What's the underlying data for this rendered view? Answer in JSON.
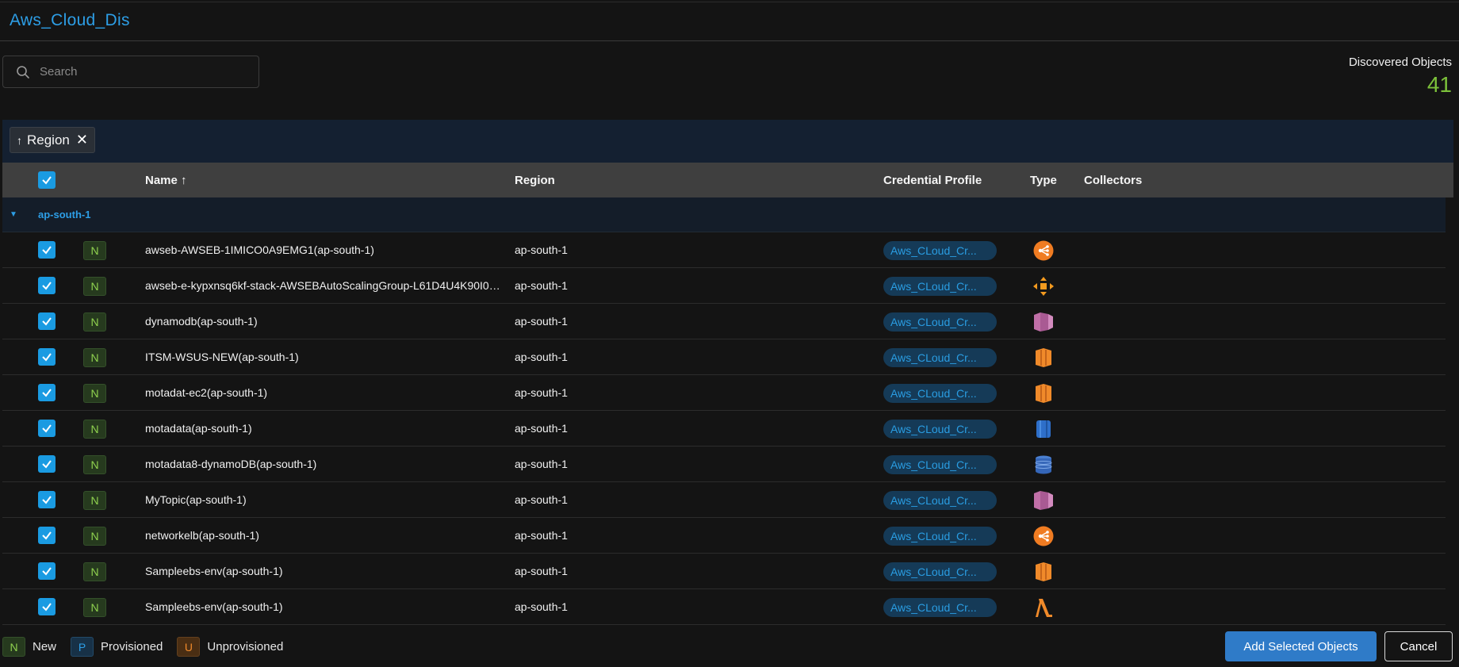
{
  "header": {
    "title": "Aws_Cloud_Dis"
  },
  "search": {
    "placeholder": "Search"
  },
  "discovered": {
    "label": "Discovered Objects",
    "count": "41"
  },
  "groupby": {
    "arrow": "↑",
    "label": "Region",
    "remove": "✕"
  },
  "columns": {
    "name": "Name ↑",
    "region": "Region",
    "credential": "Credential Profile",
    "type": "Type",
    "collectors": "Collectors"
  },
  "group": {
    "toggle": "▼",
    "name": "ap-south-1"
  },
  "rows": [
    {
      "status": "N",
      "name": "awseb-AWSEB-1IMICO0A9EMG1(ap-south-1)",
      "region": "ap-south-1",
      "credential": "Aws_CLoud_Cr...",
      "type_icon": "elb-icon"
    },
    {
      "status": "N",
      "name": "awseb-e-kypxnsq6kf-stack-AWSEBAutoScalingGroup-L61D4U4K90I0(...",
      "region": "ap-south-1",
      "credential": "Aws_CLoud_Cr...",
      "type_icon": "autoscaling-icon"
    },
    {
      "status": "N",
      "name": "dynamodb(ap-south-1)",
      "region": "ap-south-1",
      "credential": "Aws_CLoud_Cr...",
      "type_icon": "sns-icon"
    },
    {
      "status": "N",
      "name": "ITSM-WSUS-NEW(ap-south-1)",
      "region": "ap-south-1",
      "credential": "Aws_CLoud_Cr...",
      "type_icon": "ec2-icon"
    },
    {
      "status": "N",
      "name": "motadat-ec2(ap-south-1)",
      "region": "ap-south-1",
      "credential": "Aws_CLoud_Cr...",
      "type_icon": "ec2-icon"
    },
    {
      "status": "N",
      "name": "motadata(ap-south-1)",
      "region": "ap-south-1",
      "credential": "Aws_CLoud_Cr...",
      "type_icon": "rds-icon"
    },
    {
      "status": "N",
      "name": "motadata8-dynamoDB(ap-south-1)",
      "region": "ap-south-1",
      "credential": "Aws_CLoud_Cr...",
      "type_icon": "dynamodb-icon"
    },
    {
      "status": "N",
      "name": "MyTopic(ap-south-1)",
      "region": "ap-south-1",
      "credential": "Aws_CLoud_Cr...",
      "type_icon": "sns-icon"
    },
    {
      "status": "N",
      "name": "networkelb(ap-south-1)",
      "region": "ap-south-1",
      "credential": "Aws_CLoud_Cr...",
      "type_icon": "elb-icon"
    },
    {
      "status": "N",
      "name": "Sampleebs-env(ap-south-1)",
      "region": "ap-south-1",
      "credential": "Aws_CLoud_Cr...",
      "type_icon": "ec2-icon"
    },
    {
      "status": "N",
      "name": "Sampleebs-env(ap-south-1)",
      "region": "ap-south-1",
      "credential": "Aws_CLoud_Cr...",
      "type_icon": "lambda-icon"
    }
  ],
  "legend": [
    {
      "badge": "N",
      "label": "New"
    },
    {
      "badge": "P",
      "label": "Provisioned"
    },
    {
      "badge": "U",
      "label": "Unprovisioned"
    }
  ],
  "actions": {
    "add": "Add Selected Objects",
    "cancel": "Cancel"
  },
  "colors": {
    "accent": "#2d9ee6",
    "count": "#7cc13a",
    "primary_button": "#2f7bc8",
    "header_bg": "#3f3f3f"
  }
}
